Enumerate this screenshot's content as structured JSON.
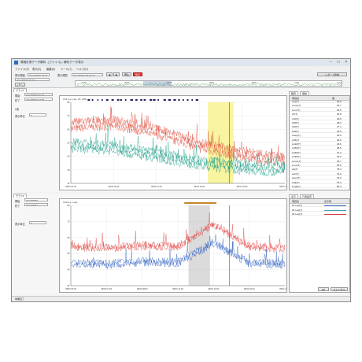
{
  "window": {
    "title": "環境計測データ解析 - [ファイル] - 解析データ表示",
    "menu": [
      "ファイル(F)",
      "表示(V)",
      "編集(E)",
      "ツール(T)",
      "ヘルプ(H)"
    ]
  },
  "toolbar": {
    "start_label": "表示開始",
    "start_value": "2012/08/30 00:00",
    "period_label": "表示期間",
    "period_value": "2012/08/30 00:00:00",
    "end_value": "2012/08/30 00:00",
    "play_label": "再生",
    "stop_label": "停止",
    "right_label": "レポート作成",
    "overview_ticks": [
      "09/01",
      "09/08",
      "09/15",
      "09/22",
      "09/29",
      "10/06",
      "10/13"
    ]
  },
  "top_panel": {
    "tab": "グラフ1",
    "start_label": "開始",
    "start_value": "2012/08/30 00:00",
    "end_label": "終了",
    "end_value": "2012/08/30 23:59",
    "check_label": "L値",
    "mode_label": "表示単位",
    "plot_title": "Ch1 (Lp, Leq, L5, L95)",
    "y_ticks": [
      "80",
      "70",
      "60",
      "50",
      "40",
      "30",
      "20"
    ],
    "x_ticks": [
      "08/30 00:00",
      "08/30 06:00",
      "08/30 12:00",
      "08/30 18:00",
      "08/31 00:00",
      "08/31 06:00"
    ],
    "list_tabs": [
      "騒音",
      "振動"
    ],
    "list_header": [
      "項目名",
      "値"
    ],
    "list_rows": [
      [
        "Leq(T)",
        "29.6"
      ],
      [
        "Lmax(T)",
        "35.7"
      ],
      [
        "Lmin(T)",
        "26.5"
      ],
      [
        "L5(T)",
        "29.8"
      ],
      [
        "L10(T)",
        "29.5"
      ],
      [
        "L50(T)",
        "28.4"
      ],
      [
        "L90(T)",
        "27.1"
      ],
      [
        "L95(T)",
        "26.8"
      ],
      [
        "LAeq(T)",
        "29.6"
      ],
      [
        "LA5(T)",
        "29.9"
      ],
      [
        "LA10(T)",
        "29.6"
      ],
      [
        "LA50(T)",
        "28.5"
      ],
      [
        "LA90(T)",
        "27.2"
      ],
      [
        "LA95(T)",
        "26.9"
      ],
      [
        "Lmax(T)",
        "35.7"
      ],
      [
        "Lmin(T)",
        "26.5"
      ],
      [
        "LE(T)",
        "78.3"
      ],
      [
        "Ldn(T)",
        "31.2"
      ],
      [
        "Lden(T)",
        "32.0"
      ],
      [
        "LAE(T)",
        "78.4"
      ],
      [
        "LCpk(T)",
        "56.3"
      ]
    ],
    "chart_data": {
      "type": "line",
      "x": [
        0,
        1,
        2,
        3,
        4,
        5
      ],
      "ylim": [
        20,
        85
      ],
      "series": [
        {
          "color": "#e05040",
          "values": [
            68,
            70,
            63,
            52,
            45,
            40
          ]
        },
        {
          "color": "#22a08a",
          "values": [
            52,
            50,
            44,
            38,
            34,
            33
          ]
        }
      ],
      "highlight_range": [
        3.2,
        3.8
      ]
    }
  },
  "bottom_panel": {
    "tab": "グラフ2",
    "start_label": "開始",
    "start_value": "2012/08/30",
    "end_label": "終了",
    "end_value": "2012/08/31",
    "mode_label": "表示単位",
    "plot_title": "Ch2 (Lp, Leq)",
    "y_ticks": [
      "80",
      "70",
      "60",
      "50",
      "40",
      "30"
    ],
    "x_ticks": [
      "08/30 00:00",
      "08/30 04:00",
      "08/30 08:00",
      "08/30 12:00",
      "08/30 16:00",
      "08/30 20:00",
      "08/31 00:00"
    ],
    "legend_tabs": [
      "表示",
      "凡例設定"
    ],
    "legend_header": [
      "項目名",
      "表示例"
    ],
    "legend_rows": [
      {
        "label": "1F Leq(T)",
        "color": "#3060c0"
      },
      {
        "label": "2F Leq(T)",
        "color": "#40a0b0"
      },
      {
        "label": "3F Leq(T)",
        "color": "#e04040"
      }
    ],
    "ok_label": "OK",
    "cancel_label": "キャンセル",
    "chart_data": {
      "type": "line",
      "x": [
        0,
        1,
        2,
        3,
        4,
        5,
        6
      ],
      "ylim": [
        25,
        85
      ],
      "series": [
        {
          "color": "#e04040",
          "values": [
            55,
            54,
            56,
            55,
            72,
            55,
            54
          ]
        },
        {
          "color": "#3060c0",
          "values": [
            43,
            42,
            44,
            43,
            58,
            43,
            42
          ]
        }
      ],
      "highlight_range": [
        3.3,
        3.9
      ]
    }
  },
  "statusbar": {
    "text": "準備完了"
  }
}
